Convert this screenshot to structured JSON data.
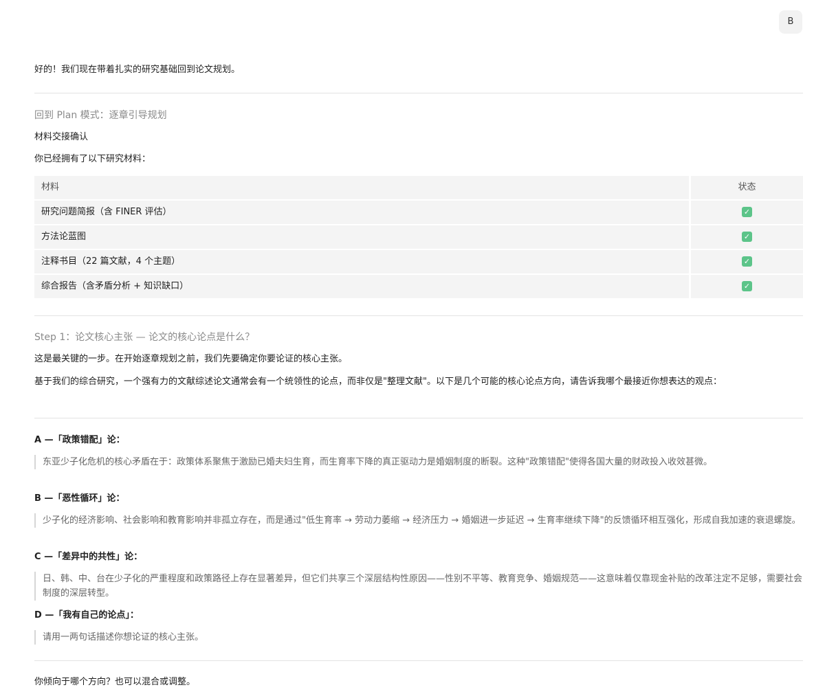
{
  "avatar_letter": "B",
  "intro": "好的！我们现在带着扎实的研究基础回到论文规划。",
  "section1": {
    "title": "回到 Plan 模式：逐章引导规划",
    "subtitle": "材料交接确认",
    "lead": "你已经拥有了以下研究材料："
  },
  "materials": {
    "headers": [
      "材料",
      "状态"
    ],
    "rows": [
      {
        "name": "研究问题简报（含 FINER 评估）",
        "status": "✓"
      },
      {
        "name": "方法论蓝图",
        "status": "✓"
      },
      {
        "name": "注释书目（22 篇文献，4 个主题）",
        "status": "✓"
      },
      {
        "name": "综合报告（含矛盾分析 + 知识缺口）",
        "status": "✓"
      }
    ],
    "status_color": "#5cc489"
  },
  "step1": {
    "title": "Step 1：论文核心主张 — 论文的核心论点是什么？",
    "lead": "这是最关键的一步。在开始逐章规划之前，我们先要确定你要论证的核心主张。",
    "body": "基于我们的综合研究，一个强有力的文献综述论文通常会有一个统领性的论点，而非仅是\"整理文献\"。以下是几个可能的核心论点方向，请告诉我哪个最接近你想表达的观点："
  },
  "options": [
    {
      "label": "A —「政策错配」论：",
      "text": "东亚少子化危机的核心矛盾在于：政策体系聚焦于激励已婚夫妇生育，而生育率下降的真正驱动力是婚姻制度的断裂。这种\"政策错配\"使得各国大量的财政投入收效甚微。"
    },
    {
      "label": "B —「恶性循环」论：",
      "text": "少子化的经济影响、社会影响和教育影响并非孤立存在，而是通过\"低生育率 → 劳动力萎缩 → 经济压力 → 婚姻进一步延迟 → 生育率继续下降\"的反馈循环相互强化，形成自我加速的衰退螺旋。"
    },
    {
      "label": "C —「差异中的共性」论：",
      "text": "日、韩、中、台在少子化的严重程度和政策路径上存在显著差异，但它们共享三个深层结构性原因——性别不平等、教育竞争、婚姻规范——这意味着仅靠现金补贴的改革注定不足够，需要社会制度的深层转型。"
    },
    {
      "label": "D —「我有自己的论点」：",
      "text": "请用一两句话描述你想论证的核心主张。"
    }
  ],
  "closing": "你倾向于哪个方向？也可以混合或调整。"
}
